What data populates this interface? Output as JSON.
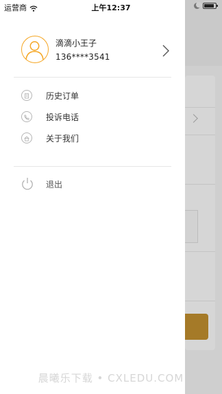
{
  "status_bar": {
    "carrier": "运营商",
    "time": "上午12:37"
  },
  "drawer": {
    "profile": {
      "name": "滴滴小王子",
      "phone": "136****3541"
    },
    "menu": [
      {
        "label": "历史订单",
        "icon": "receipt-icon"
      },
      {
        "label": "投诉电话",
        "icon": "phone-icon"
      },
      {
        "label": "关于我们",
        "icon": "home-icon"
      }
    ],
    "logout": {
      "label": "退出",
      "icon": "power-icon"
    }
  },
  "watermark": "晨曦乐下载 • CXLEDU.COM",
  "colors": {
    "accent": "#f5a623",
    "overlay_button": "#a57a28",
    "icon_gray": "#b5b5b5"
  }
}
